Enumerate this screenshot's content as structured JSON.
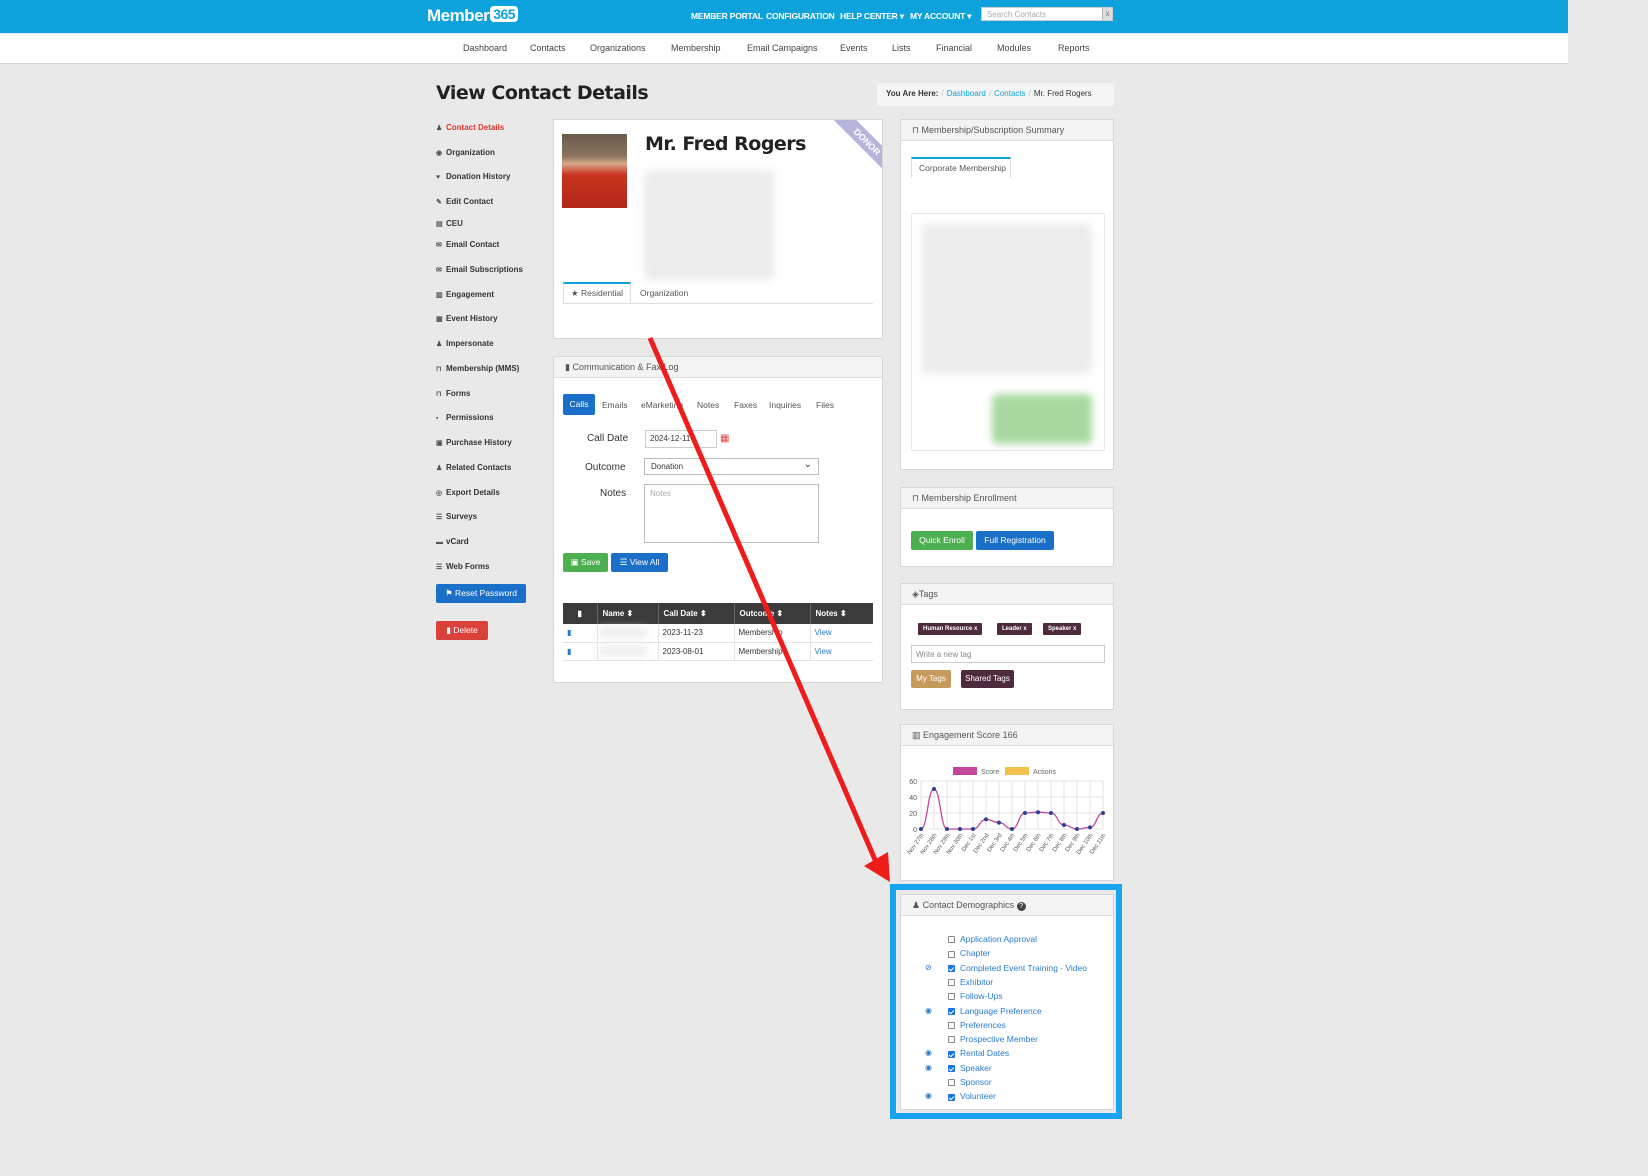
{
  "app": {
    "logo_text": "Member",
    "logo_box": "365",
    "search_placeholder": "Search Contacts",
    "search_clear": "x"
  },
  "topnav": [
    "MEMBER PORTAL",
    "CONFIGURATION",
    "HELP CENTER ▾",
    "MY ACCOUNT ▾"
  ],
  "subnav": [
    "Dashboard",
    "Contacts",
    "Organizations",
    "Membership",
    "Email Campaigns",
    "Events",
    "Lists",
    "Financial",
    "Modules",
    "Reports"
  ],
  "page_title": "View Contact Details",
  "breadcrumb": {
    "label": "You Are Here:",
    "items": [
      "Dashboard",
      "Contacts",
      "Mr. Fred Rogers"
    ]
  },
  "sidebar": [
    {
      "icon": "user-icon",
      "glyph": "♟",
      "label": "Contact Details",
      "active": true
    },
    {
      "icon": "eye-icon",
      "glyph": "◉",
      "label": "Organization"
    },
    {
      "icon": "heart-icon",
      "glyph": "♥",
      "label": "Donation History"
    },
    {
      "icon": "edit-icon",
      "glyph": "✎",
      "label": "Edit Contact"
    },
    {
      "icon": "book-icon",
      "glyph": "▤",
      "label": "CEU"
    },
    {
      "icon": "envelope-icon",
      "glyph": "✉",
      "label": "Email Contact"
    },
    {
      "icon": "envelope-icon",
      "glyph": "✉",
      "label": "Email Subscriptions"
    },
    {
      "icon": "bar-chart-icon",
      "glyph": "▥",
      "label": "Engagement"
    },
    {
      "icon": "calendar-icon",
      "glyph": "▦",
      "label": "Event History"
    },
    {
      "icon": "user-icon",
      "glyph": "♟",
      "label": "Impersonate"
    },
    {
      "icon": "bookmark-icon",
      "glyph": "⊓",
      "label": "Membership (MMS)"
    },
    {
      "icon": "bookmark-icon",
      "glyph": "⊓",
      "label": "Forms"
    },
    {
      "icon": "lock-icon",
      "glyph": "▪",
      "label": "Permissions"
    },
    {
      "icon": "cart-icon",
      "glyph": "▣",
      "label": "Purchase History"
    },
    {
      "icon": "users-icon",
      "glyph": "♟",
      "label": "Related Contacts"
    },
    {
      "icon": "export-icon",
      "glyph": "◎",
      "label": "Export Details"
    },
    {
      "icon": "list-icon",
      "glyph": "☰",
      "label": "Surveys"
    },
    {
      "icon": "card-icon",
      "glyph": "▬",
      "label": "vCard"
    },
    {
      "icon": "list-icon",
      "glyph": "☰",
      "label": "Web Forms"
    }
  ],
  "buttons": {
    "reset_password": "Reset Password",
    "delete": "Delete"
  },
  "contact": {
    "name": "Mr. Fred Rogers",
    "ribbon": "DONOR",
    "tabs": [
      "Residential",
      "Organization"
    ]
  },
  "comm_log": {
    "title": "Communication & Fax Log",
    "tabs": [
      "Calls",
      "Emails",
      "eMarketing",
      "Notes",
      "Faxes",
      "Inquiries",
      "Files"
    ],
    "call_date_label": "Call Date",
    "call_date": "2024-12-11",
    "outcome_label": "Outcome",
    "outcome": "Donation",
    "notes_label": "Notes",
    "notes_placeholder": "Notes",
    "save": "Save",
    "view_all": "View All",
    "columns": [
      "",
      "Name",
      "Call Date",
      "Outcome",
      "Notes"
    ],
    "rows": [
      {
        "date": "2023-11-23",
        "outcome": "Membership",
        "notes": "View"
      },
      {
        "date": "2023-08-01",
        "outcome": "Membership",
        "notes": "View"
      }
    ]
  },
  "membership_summary": {
    "title": "Membership/Subscription Summary",
    "tab": "Corporate Membership"
  },
  "enrollment": {
    "title": "Membership Enrollment",
    "quick": "Quick Enroll",
    "full": "Full Registration"
  },
  "tags": {
    "title": "Tags",
    "items": [
      "Human Resource",
      "Leader",
      "Speaker"
    ],
    "input_placeholder": "Write a new tag",
    "my_tags": "My Tags",
    "shared_tags": "Shared Tags"
  },
  "engagement": {
    "title": "Engagement Score 166"
  },
  "chart_data": {
    "type": "line",
    "title": "",
    "xlabel": "",
    "ylabel": "",
    "ylim": [
      0,
      60
    ],
    "yticks": [
      0,
      20,
      40,
      60
    ],
    "categories": [
      "Nov 27th",
      "Nov 28th",
      "Nov 29th",
      "Nov 30th",
      "Dec 1st",
      "Dec 2nd",
      "Dec 3rd",
      "Dec 4th",
      "Dec 5th",
      "Dec 6th",
      "Dec 7th",
      "Dec 8th",
      "Dec 9th",
      "Dec 10th",
      "Dec 11th"
    ],
    "series": [
      {
        "name": "Score",
        "color": "#c2469a",
        "values": [
          0,
          50,
          0,
          0,
          0,
          12,
          8,
          0,
          20,
          21,
          20,
          5,
          0,
          2,
          20
        ]
      },
      {
        "name": "Actions",
        "color": "#f4c150",
        "values": []
      }
    ]
  },
  "demographics": {
    "title": "Contact Demographics",
    "items": [
      {
        "label": "Application Approval",
        "checked": false,
        "icon": ""
      },
      {
        "label": "Chapter",
        "checked": false,
        "icon": ""
      },
      {
        "label": "Completed Event Training - Video",
        "checked": true,
        "icon": "⊘"
      },
      {
        "label": "Exhibitor",
        "checked": false,
        "icon": ""
      },
      {
        "label": "Follow-Ups",
        "checked": false,
        "icon": ""
      },
      {
        "label": "Language Preference",
        "checked": true,
        "icon": "◉"
      },
      {
        "label": "Preferences",
        "checked": false,
        "icon": ""
      },
      {
        "label": "Prospective Member",
        "checked": false,
        "icon": ""
      },
      {
        "label": "Rental Dates",
        "checked": true,
        "icon": "◉"
      },
      {
        "label": "Speaker",
        "checked": true,
        "icon": "◉"
      },
      {
        "label": "Sponsor",
        "checked": false,
        "icon": ""
      },
      {
        "label": "Volunteer",
        "checked": true,
        "icon": "◉"
      }
    ]
  }
}
